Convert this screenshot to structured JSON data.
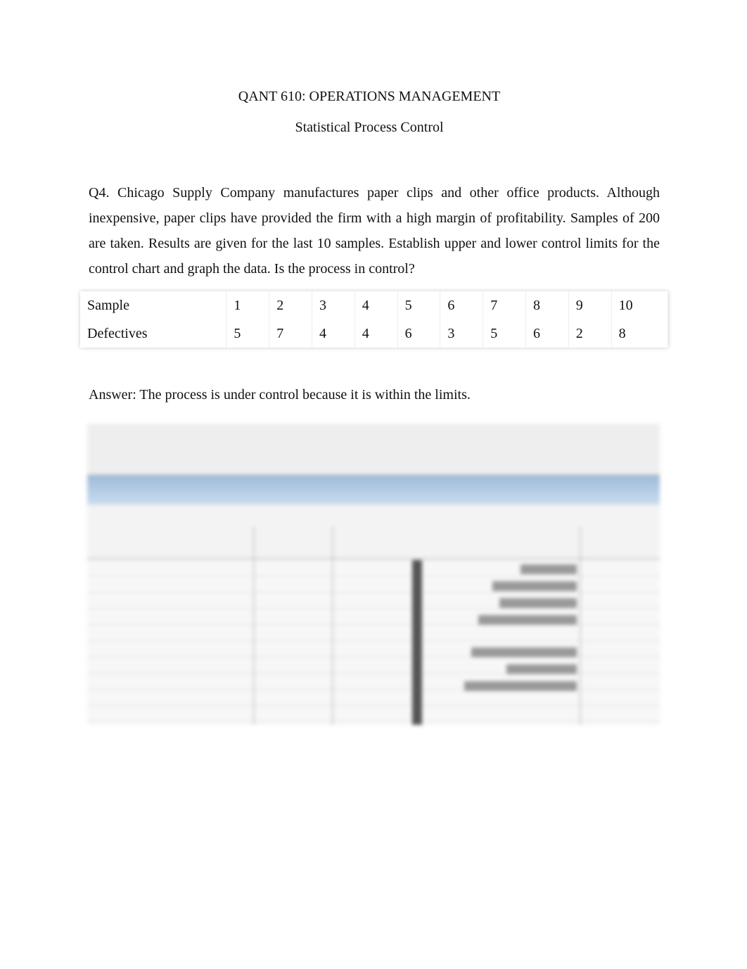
{
  "header": {
    "course": "QANT 610: OPERATIONS MANAGEMENT",
    "topic": "Statistical Process Control"
  },
  "question": "Q4. Chicago Supply Company manufactures paper clips and other office products. Although inexpensive, paper clips have provided the firm with a high margin of profitability. Samples of 200 are taken. Results are given for the last 10 samples. Establish upper and lower control limits for the control chart and graph the data. Is the process in control?",
  "table": {
    "rows": [
      [
        "Sample",
        "1",
        "2",
        "3",
        "4",
        "5",
        "6",
        "7",
        "8",
        "9",
        "10"
      ],
      [
        "Defectives",
        "5",
        "7",
        "4",
        "4",
        "6",
        "3",
        "5",
        "6",
        "2",
        "8"
      ]
    ]
  },
  "answer": "Answer: The process is under control because it is within the limits.",
  "screenshot": {
    "accent": "#9fbbd8",
    "blurred": true
  }
}
